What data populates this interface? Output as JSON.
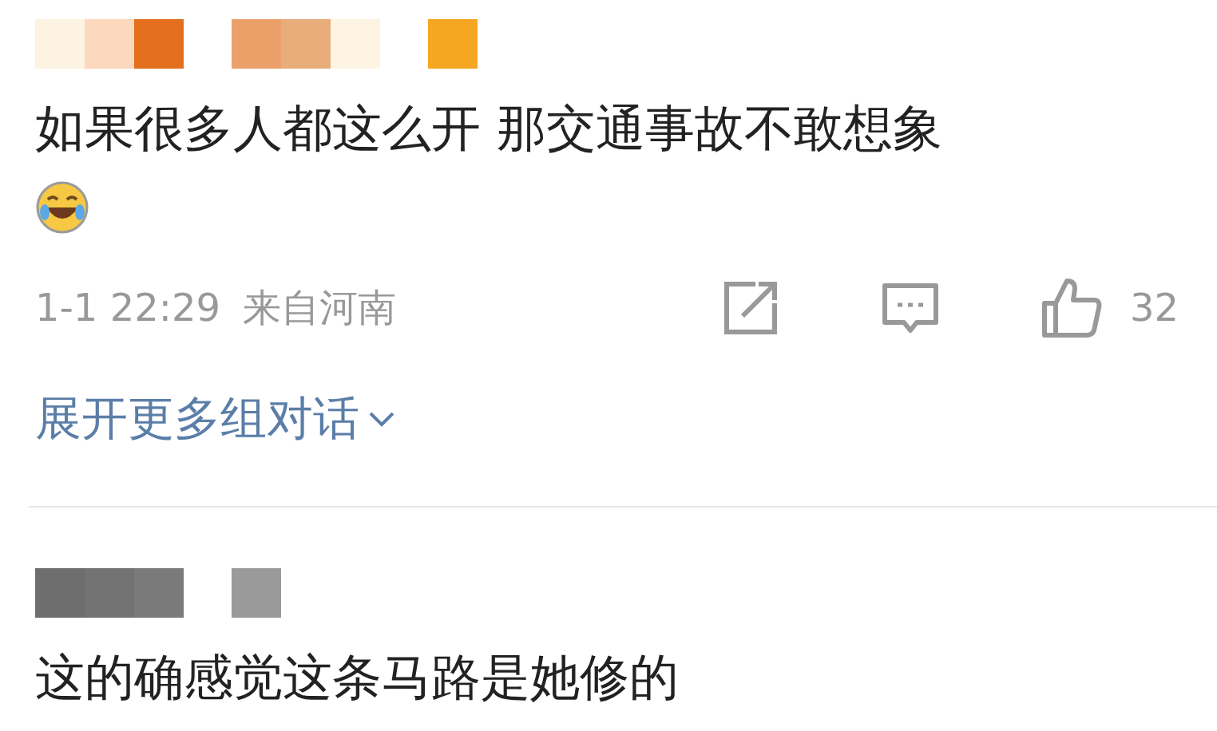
{
  "comments": [
    {
      "kind": "warm",
      "text": "如果很多人都这么开 那交通事故不敢想象",
      "emoji": true,
      "time": "1-1 22:29",
      "location": "来自河南",
      "likes": "32",
      "expand": "展开更多组对话"
    },
    {
      "kind": "grey",
      "text": "这的确感觉这条马路是她修的",
      "emoji": false
    }
  ]
}
